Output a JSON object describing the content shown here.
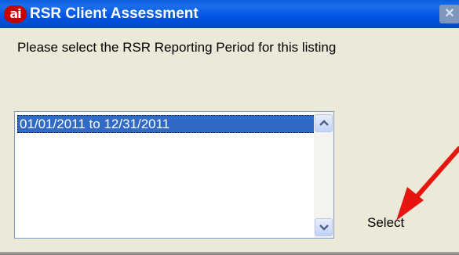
{
  "window": {
    "title": "RSR Client Assessment",
    "app_icon_text": "ai",
    "close_symbol": "✕"
  },
  "prompt": {
    "text": "Please select the RSR Reporting Period for this listing"
  },
  "periods": {
    "items": [
      "01/01/2011 to 12/31/2011"
    ],
    "selected": "01/01/2011 to 12/31/2011"
  },
  "actions": {
    "select_label": "Select"
  },
  "colors": {
    "titlebar": "#0054E3",
    "selection": "#316AC5",
    "annotation_arrow": "#E8140F",
    "window_background": "#ECE9D8"
  },
  "annotations": {
    "arrow": "red-arrow-pointing-to-select-button"
  }
}
